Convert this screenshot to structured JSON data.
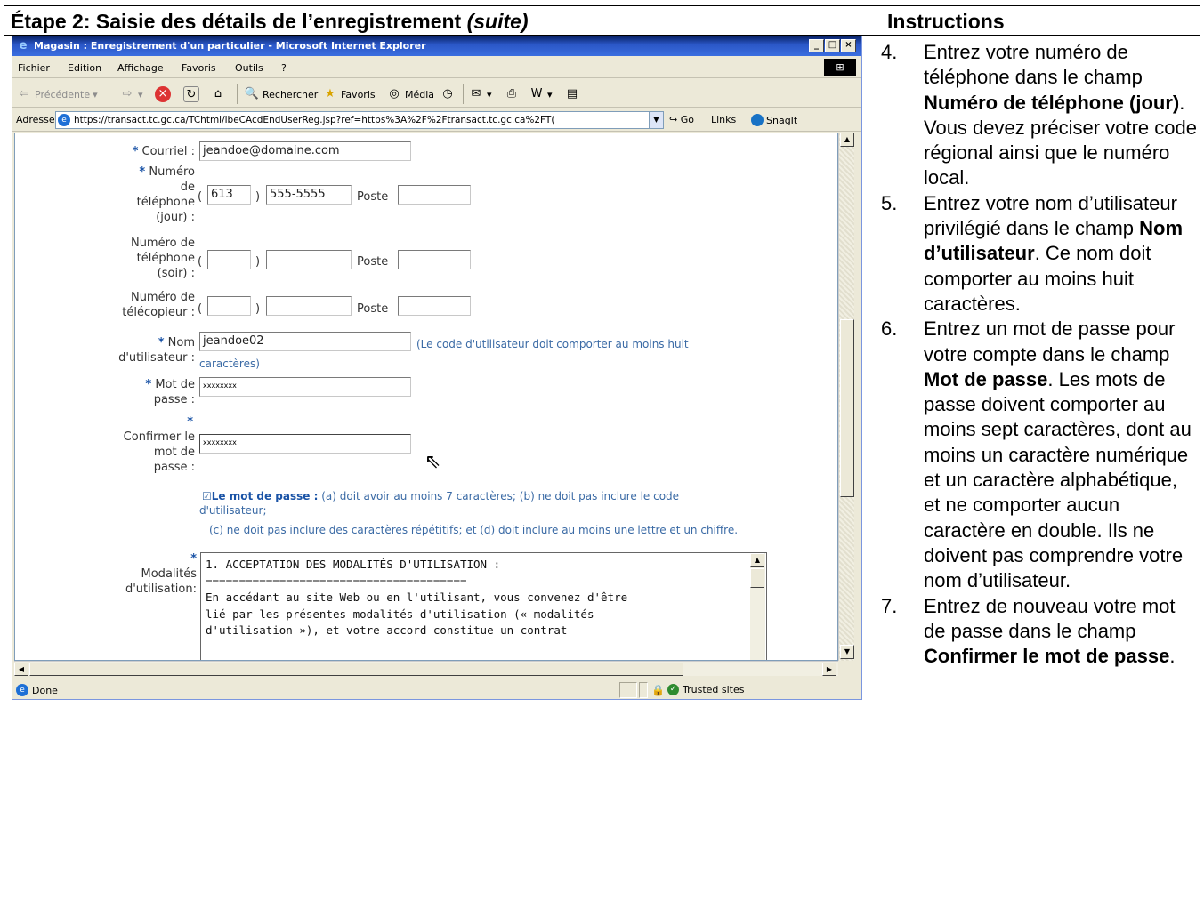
{
  "step_heading": {
    "main": "Étape 2: Saisie des détails de l’enregistrement ",
    "suffix": "(suite)"
  },
  "instructions_heading": "Instructions",
  "instructions": [
    {
      "num": "4.",
      "parts": [
        "Entrez votre numéro de téléphone dans le champ ",
        "Numéro de téléphone (jour)",
        ". Vous devez préciser votre code régional ainsi que le numéro local."
      ]
    },
    {
      "num": "5.",
      "parts": [
        "Entrez votre nom d’utilisateur privilégié dans le champ ",
        "Nom d’utilisateur",
        ". Ce nom doit comporter au moins huit caractères."
      ]
    },
    {
      "num": "6.",
      "parts": [
        "Entrez un mot de passe pour votre compte dans le champ ",
        "Mot de passe",
        ". Les mots de passe doivent comporter au moins sept caractères, dont au moins un caractère numérique et un caractère alphabétique, et ne comporter aucun caractère en double. Ils ne doivent pas comprendre votre nom d’utilisateur."
      ]
    },
    {
      "num": "7.",
      "parts": [
        "Entrez de nouveau votre mot de passe dans le champ ",
        "Confirmer le mot de passe",
        "."
      ]
    }
  ],
  "browser": {
    "title": "Magasin : Enregistrement d'un particulier - Microsoft Internet Explorer",
    "menu": [
      "Fichier",
      "Edition",
      "Affichage",
      "Favoris",
      "Outils",
      "?"
    ],
    "toolbar": {
      "back": "Précédente",
      "search": "Rechercher",
      "favorites": "Favoris",
      "media": "Média"
    },
    "address_label": "Adresse",
    "url": "https://transact.tc.gc.ca/TChtml/ibeCAcdEndUserReg.jsp?ref=https%3A%2F%2Ftransact.tc.gc.ca%2FT(",
    "go": "Go",
    "links": "Links",
    "snagit": "SnagIt",
    "status": "Done",
    "zone": "Trusted sites"
  },
  "form": {
    "email_label": "Courriel :",
    "email_value": "jeandoe@domaine.com",
    "day_phone_label": [
      "Numéro",
      "de",
      "téléphone",
      "(jour) :"
    ],
    "day_area": "613",
    "day_number": "555-5555",
    "poste": "Poste",
    "evening_phone_label": [
      "Numéro de",
      "téléphone",
      "(soir) :"
    ],
    "fax_label": [
      "Numéro de",
      "télécopieur :"
    ],
    "username_label": [
      "Nom",
      "d'utilisateur :"
    ],
    "username_value": "jeandoe02",
    "username_hint": "(Le code d'utilisateur doit comporter au moins huit",
    "username_hint2": "caractères)",
    "password_label": [
      "Mot de",
      "passe :"
    ],
    "password_value": "xxxxxxxx",
    "confirm_label": [
      "Confirmer le",
      "mot de",
      "passe :"
    ],
    "confirm_value": "xxxxxxxx",
    "pw_rule_title": "Le mot de passe :",
    "pw_rule_1": " (a) doit avoir au moins 7 caractères; (b) ne doit pas inclure le code",
    "pw_rule_2": "d'utilisateur;",
    "pw_rule_3": "(c) ne doit pas inclure des caractères répétitifs; et (d) doit inclure au moins une lettre et un chiffre.",
    "terms_label": [
      "Modalités",
      "d'utilisation:"
    ],
    "terms_text": "1. ACCEPTATION DES MODALITÉS D'UTILISATION :\n=======================================\nEn accédant au site Web ou en l'utilisant, vous convenez d'être\nlié par les présentes modalités d'utilisation (« modalités\nd'utilisation »), et votre accord constitue un contrat"
  }
}
